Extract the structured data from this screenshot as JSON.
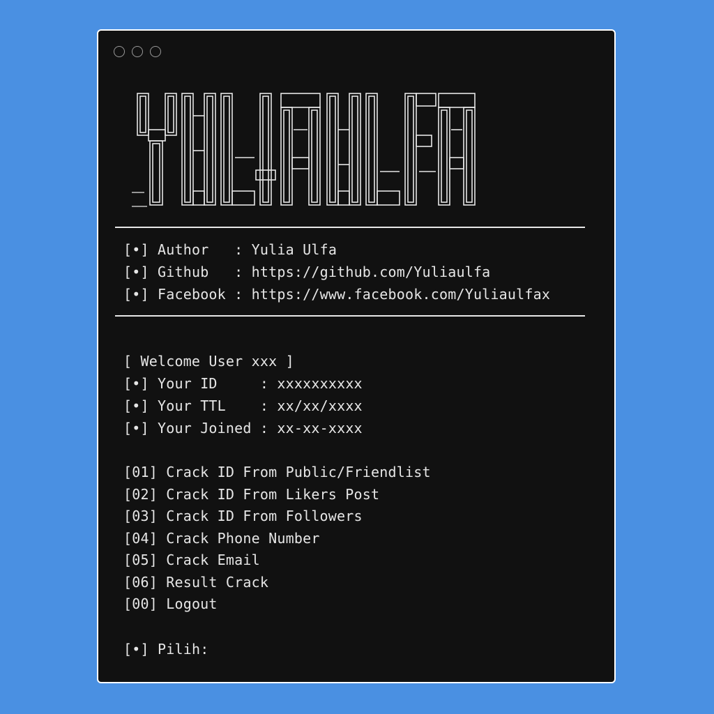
{
  "window": {
    "controls": [
      "circle-icon",
      "circle-icon",
      "circle-icon"
    ]
  },
  "banner": {
    "text": "YULIAULFA"
  },
  "info": [
    {
      "bullet": "[•]",
      "label": "Author  ",
      "sep": ":",
      "value": "Yulia Ulfa"
    },
    {
      "bullet": "[•]",
      "label": "Github  ",
      "sep": ":",
      "value": "https://github.com/Yuliaulfa"
    },
    {
      "bullet": "[•]",
      "label": "Facebook",
      "sep": ":",
      "value": "https://www.facebook.com/Yuliaulfax"
    }
  ],
  "welcome": "[ Welcome User xxx ]",
  "user": [
    {
      "bullet": "[•]",
      "label": "Your ID    ",
      "sep": ":",
      "value": "xxxxxxxxxx"
    },
    {
      "bullet": "[•]",
      "label": "Your TTL   ",
      "sep": ":",
      "value": "xx/xx/xxxx"
    },
    {
      "bullet": "[•]",
      "label": "Your Joined",
      "sep": ":",
      "value": "xx-xx-xxxx"
    }
  ],
  "menu": [
    {
      "num": "[01]",
      "label": "Crack ID From Public/Friendlist"
    },
    {
      "num": "[02]",
      "label": "Crack ID From Likers Post"
    },
    {
      "num": "[03]",
      "label": "Crack ID From Followers"
    },
    {
      "num": "[04]",
      "label": "Crack Phone Number"
    },
    {
      "num": "[05]",
      "label": "Crack Email"
    },
    {
      "num": "[06]",
      "label": "Result Crack"
    },
    {
      "num": "[00]",
      "label": "Logout"
    }
  ],
  "prompt": {
    "bullet": "[•]",
    "label": "Pilih:",
    "value": ""
  },
  "colors": {
    "background": "#4a90e2",
    "terminal": "#111111",
    "text": "#e6e6e6",
    "border": "#ffffff"
  }
}
